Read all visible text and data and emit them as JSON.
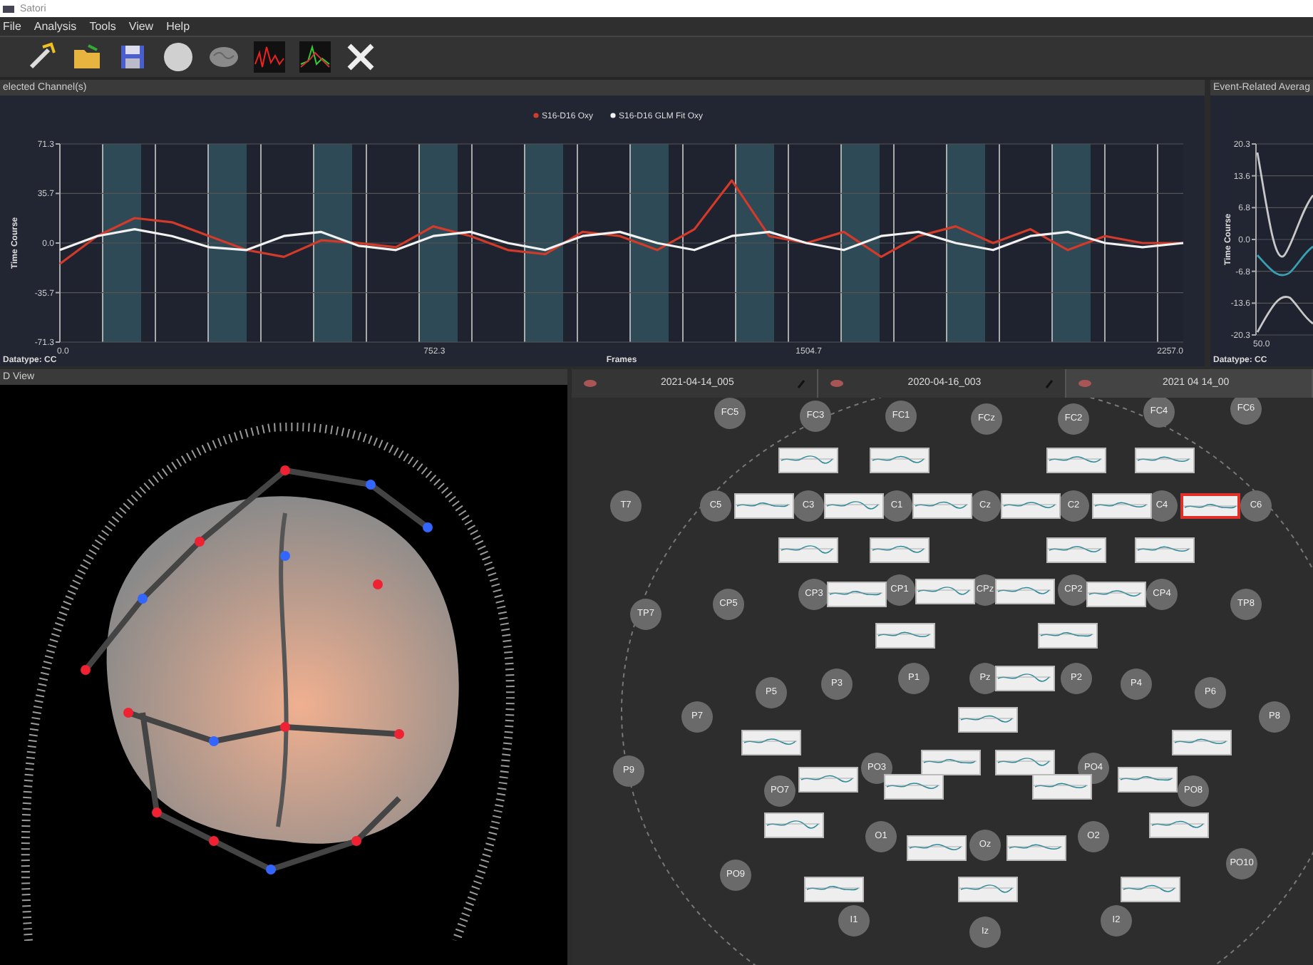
{
  "window": {
    "title": "Satori"
  },
  "menu": [
    {
      "label": "File"
    },
    {
      "label": "Analysis"
    },
    {
      "label": "Tools"
    },
    {
      "label": "View"
    },
    {
      "label": "Help"
    }
  ],
  "toolbar": [
    {
      "kind": "wand"
    },
    {
      "kind": "folder"
    },
    {
      "kind": "save"
    },
    {
      "kind": "sphere"
    },
    {
      "kind": "brain"
    },
    {
      "kind": "signal-red"
    },
    {
      "kind": "signal-green"
    },
    {
      "kind": "tools"
    }
  ],
  "selected_channels_panel": {
    "title": "elected Channel(s)",
    "datatype": "Datatype: CC",
    "chart_data": {
      "type": "line",
      "xlabel": "Frames",
      "ylabel": "Time Course",
      "x": [
        0,
        75,
        150,
        225,
        300,
        375,
        450,
        525,
        600,
        675,
        750,
        825,
        900,
        975,
        1050,
        1125,
        1200,
        1275,
        1350,
        1425,
        1500,
        1575,
        1650,
        1725,
        1800,
        1875,
        1950,
        2025,
        2100,
        2175,
        2257
      ],
      "series": [
        {
          "name": "S16-D16 Oxy",
          "color": "#d23a2a",
          "values": [
            -15,
            5,
            18,
            15,
            5,
            -5,
            -10,
            2,
            0,
            -3,
            12,
            5,
            -5,
            -8,
            8,
            5,
            -5,
            10,
            45,
            5,
            0,
            8,
            -10,
            5,
            12,
            0,
            10,
            -5,
            5,
            0,
            0
          ]
        },
        {
          "name": "S16-D16 GLM Fit Oxy",
          "color": "#f2f2f2",
          "values": [
            -5,
            5,
            10,
            5,
            -3,
            -5,
            5,
            8,
            -2,
            -5,
            5,
            8,
            0,
            -5,
            5,
            8,
            0,
            -5,
            5,
            8,
            0,
            -5,
            5,
            8,
            0,
            -5,
            5,
            8,
            0,
            -3,
            0
          ]
        }
      ],
      "xlim": [
        0,
        2257
      ],
      "ylim": [
        -71.3,
        71.3
      ],
      "grid": true,
      "legend": true,
      "xticks": [
        {
          "value": 0,
          "label": "0.0"
        },
        {
          "value": 752.3,
          "label": "752.3"
        },
        {
          "value": 1504.7,
          "label": "1504.7"
        },
        {
          "value": 2257,
          "label": "2257.0"
        }
      ],
      "yticks": [
        {
          "value": 71.3,
          "label": "71.3"
        },
        {
          "value": 35.7,
          "label": "35.7"
        },
        {
          "value": 0,
          "label": "0.0"
        },
        {
          "value": -35.7,
          "label": "-35.7"
        },
        {
          "value": -71.3,
          "label": "-71.3"
        }
      ]
    }
  },
  "event_related_panel": {
    "title": "Event-Related Averag",
    "datatype": "Datatype: CC",
    "y_axis_title": "Time Course",
    "y_tick_labels": [
      "20.3",
      "13.6",
      "6.8",
      "0.0",
      "-6.8",
      "-13.6",
      "-20.3"
    ],
    "x_tick_label": "50.0"
  },
  "view_3d_panel": {
    "title": "D View"
  },
  "montage_panel": {
    "tabs": [
      {
        "label": "2021-04-14_005",
        "selected": false
      },
      {
        "label": "2020-04-16_003",
        "selected": false
      },
      {
        "label": "2021 04 14_00",
        "selected": true
      }
    ],
    "optodes": [
      {
        "label": "FC5"
      },
      {
        "label": "FC3"
      },
      {
        "label": "FC1"
      },
      {
        "label": "FCz"
      },
      {
        "label": "FC2"
      },
      {
        "label": "FC4"
      },
      {
        "label": "FC6"
      },
      {
        "label": "T7"
      },
      {
        "label": "C5"
      },
      {
        "label": "C3"
      },
      {
        "label": "C1"
      },
      {
        "label": "Cz"
      },
      {
        "label": "C2"
      },
      {
        "label": "C4"
      },
      {
        "label": "C6"
      },
      {
        "label": "TP7"
      },
      {
        "label": "CP5"
      },
      {
        "label": "CP3"
      },
      {
        "label": "CP1"
      },
      {
        "label": "CPz"
      },
      {
        "label": "CP2"
      },
      {
        "label": "CP4"
      },
      {
        "label": "TP8"
      },
      {
        "label": "P5"
      },
      {
        "label": "P3"
      },
      {
        "label": "P1"
      },
      {
        "label": "Pz"
      },
      {
        "label": "P2"
      },
      {
        "label": "P4"
      },
      {
        "label": "P6"
      },
      {
        "label": "P7"
      },
      {
        "label": "P8"
      },
      {
        "label": "P9"
      },
      {
        "label": "PO7"
      },
      {
        "label": "PO3"
      },
      {
        "label": "PO4"
      },
      {
        "label": "PO8"
      },
      {
        "label": "O1"
      },
      {
        "label": "Oz"
      },
      {
        "label": "O2"
      },
      {
        "label": "PO9"
      },
      {
        "label": "PO10"
      },
      {
        "label": "I1"
      },
      {
        "label": "Iz"
      },
      {
        "label": "I2"
      }
    ],
    "channel_plots": [
      {
        "selected": false
      },
      {
        "selected": false
      },
      {
        "selected": false
      },
      {
        "selected": false
      },
      {
        "selected": false
      },
      {
        "selected": false
      },
      {
        "selected": false
      },
      {
        "selected": false
      },
      {
        "selected": false
      },
      {
        "selected": true
      },
      {
        "selected": false
      },
      {
        "selected": false
      },
      {
        "selected": false
      },
      {
        "selected": false
      },
      {
        "selected": false
      },
      {
        "selected": false
      },
      {
        "selected": false
      },
      {
        "selected": false
      },
      {
        "selected": false
      },
      {
        "selected": false
      },
      {
        "selected": false
      },
      {
        "selected": false
      },
      {
        "selected": false
      },
      {
        "selected": false
      },
      {
        "selected": false
      },
      {
        "selected": false
      },
      {
        "selected": false
      },
      {
        "selected": false
      },
      {
        "selected": false
      },
      {
        "selected": false
      },
      {
        "selected": false
      },
      {
        "selected": false
      },
      {
        "selected": false
      },
      {
        "selected": false
      },
      {
        "selected": false
      },
      {
        "selected": false
      },
      {
        "selected": false
      }
    ]
  }
}
